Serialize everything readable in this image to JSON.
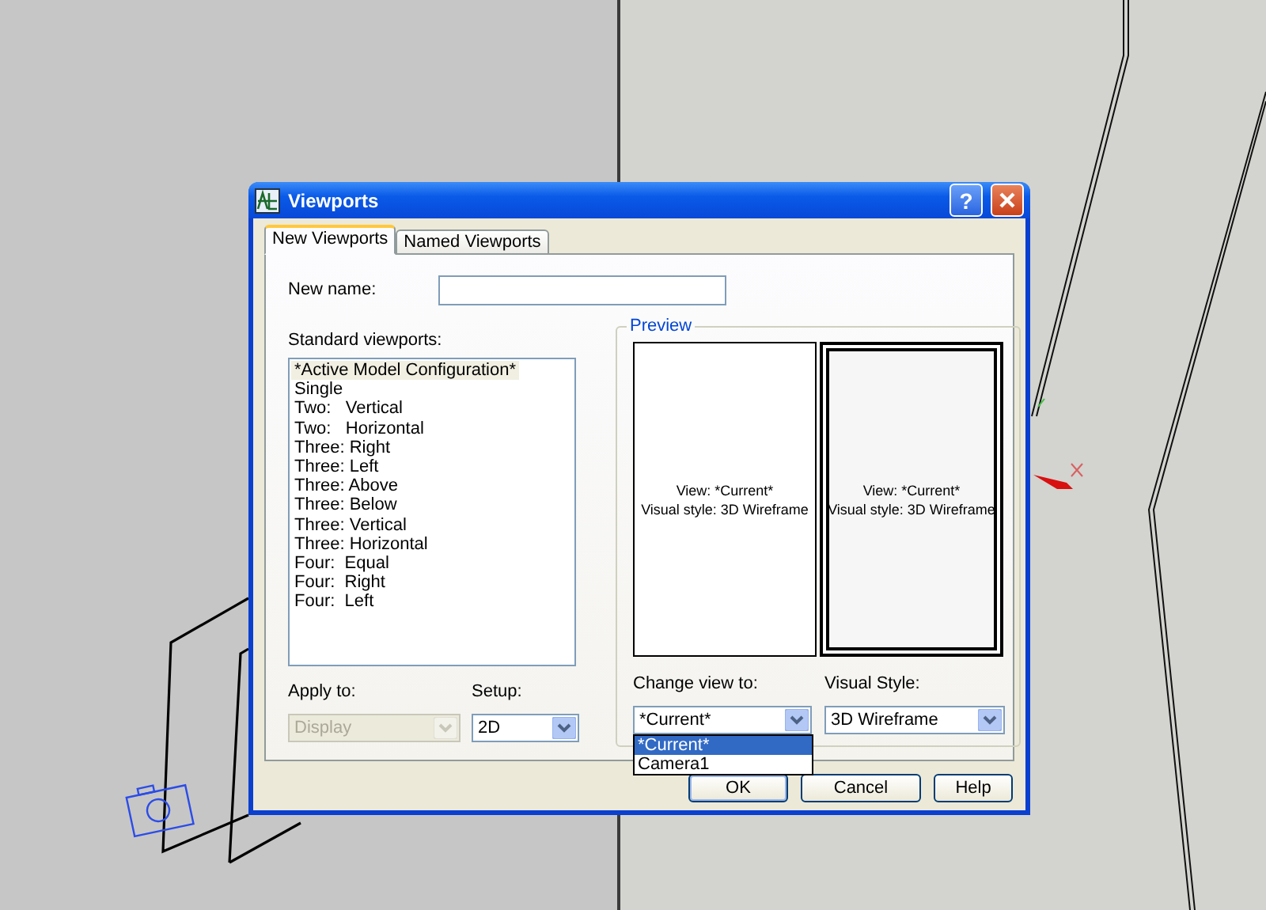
{
  "window": {
    "title": "Viewports",
    "help_button": "?"
  },
  "tabs": [
    {
      "label": "New Viewports",
      "selected": true
    },
    {
      "label": "Named Viewports",
      "selected": false
    }
  ],
  "new_name": {
    "label": "New name:"
  },
  "standard_viewports": {
    "label": "Standard viewports:",
    "items": [
      {
        "label": "*Active Model Configuration*",
        "selected": true
      },
      {
        "label": "Single",
        "selected": false
      },
      {
        "label": "Two:   Vertical",
        "selected": false
      },
      {
        "label": "Two:   Horizontal",
        "selected": false
      },
      {
        "label": "Three: Right",
        "selected": false
      },
      {
        "label": "Three: Left",
        "selected": false
      },
      {
        "label": "Three: Above",
        "selected": false
      },
      {
        "label": "Three: Below",
        "selected": false
      },
      {
        "label": "Three: Vertical",
        "selected": false
      },
      {
        "label": "Three: Horizontal",
        "selected": false
      },
      {
        "label": "Four:  Equal",
        "selected": false
      },
      {
        "label": "Four:  Right",
        "selected": false
      },
      {
        "label": "Four:  Left",
        "selected": false
      }
    ]
  },
  "apply_to": {
    "label": "Apply to:",
    "value": "Display",
    "disabled": true
  },
  "setup": {
    "label": "Setup:",
    "value": "2D",
    "disabled": false
  },
  "preview": {
    "label": "Preview",
    "panes": [
      {
        "view": "View: *Current*",
        "style": "Visual style: 3D Wireframe",
        "selected": false
      },
      {
        "view": "View: *Current*",
        "style": "Visual style: 3D Wireframe",
        "selected": true
      }
    ]
  },
  "change_view": {
    "label": "Change view to:",
    "value": "*Current*",
    "expanded": true,
    "options": [
      {
        "label": "*Current*",
        "selected": true
      },
      {
        "label": "Camera1",
        "selected": false
      }
    ]
  },
  "visual_style": {
    "label": "Visual Style:",
    "value": "3D Wireframe"
  },
  "buttons": [
    {
      "label": "OK",
      "default": true
    },
    {
      "label": "Cancel",
      "default": false
    },
    {
      "label": "Help",
      "default": false
    }
  ]
}
